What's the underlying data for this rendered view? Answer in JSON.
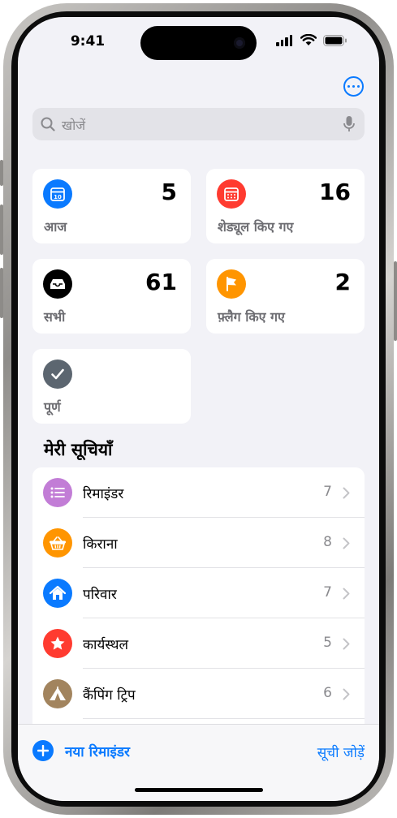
{
  "status_bar": {
    "time": "9:41"
  },
  "header": {
    "more_icon": "ellipsis-circle-icon"
  },
  "search": {
    "placeholder": "खोजें",
    "icon": "magnifier-icon",
    "mic_icon": "microphone-icon"
  },
  "smart_lists": [
    {
      "id": "today",
      "label": "आज",
      "count": "5",
      "color": "#0a7aff",
      "icon": "calendar-today-icon"
    },
    {
      "id": "scheduled",
      "label": "शेड्यूल किए गए",
      "count": "16",
      "color": "#ff3b30",
      "icon": "calendar-grid-icon"
    },
    {
      "id": "all",
      "label": "सभी",
      "count": "61",
      "color": "#000000",
      "icon": "tray-icon"
    },
    {
      "id": "flagged",
      "label": "फ़्लैग किए गए",
      "count": "2",
      "color": "#ff9500",
      "icon": "flag-icon"
    },
    {
      "id": "completed",
      "label": "पूर्ण",
      "count": "",
      "color": "#5c6670",
      "icon": "checkmark-icon"
    }
  ],
  "my_lists": {
    "title": "मेरी सूचियाँ",
    "items": [
      {
        "name": "रिमाइंडर",
        "count": "7",
        "color": "#c27dd6",
        "icon": "list-bullet-icon"
      },
      {
        "name": "किराना",
        "count": "8",
        "color": "#ff9500",
        "icon": "basket-icon"
      },
      {
        "name": "परिवार",
        "count": "7",
        "color": "#0a7aff",
        "icon": "house-icon"
      },
      {
        "name": "कार्यस्थल",
        "count": "5",
        "color": "#ff3b30",
        "icon": "star-icon"
      },
      {
        "name": "कैंपिंग ट्रिप",
        "count": "6",
        "color": "#a2845e",
        "icon": "tent-icon"
      }
    ]
  },
  "toolbar": {
    "new_reminder": "नया रिमाइंडर",
    "add_list": "सूची जोड़ें"
  }
}
